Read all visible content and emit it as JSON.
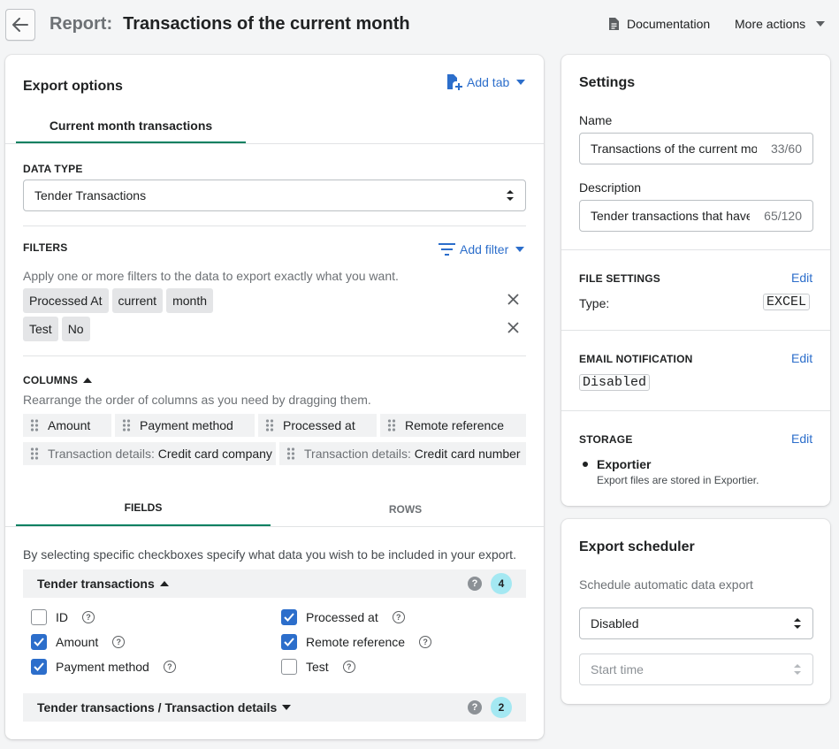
{
  "header": {
    "title_prefix": "Report:",
    "title": "Transactions of the current month",
    "documentation_label": "Documentation",
    "more_actions_label": "More actions"
  },
  "export_options": {
    "title": "Export options",
    "add_tab_label": "Add tab",
    "tabs": [
      {
        "label": "Current month transactions",
        "active": true
      }
    ],
    "data_type": {
      "heading": "DATA TYPE",
      "value": "Tender Transactions"
    },
    "filters": {
      "heading": "FILTERS",
      "add_filter_label": "Add filter",
      "description": "Apply one or more filters to the data to export exactly what you want.",
      "rows": [
        {
          "chips": [
            "Processed At",
            "current",
            "month"
          ]
        },
        {
          "chips": [
            "Test",
            "No"
          ]
        }
      ]
    },
    "columns": {
      "heading": "COLUMNS",
      "description": "Rearrange the order of columns as you need by dragging them.",
      "items": [
        {
          "prefix": "",
          "label": "Amount"
        },
        {
          "prefix": "",
          "label": "Payment method"
        },
        {
          "prefix": "",
          "label": "Processed at"
        },
        {
          "prefix": "",
          "label": "Remote reference"
        },
        {
          "prefix": "Transaction details:",
          "label": "Credit card company"
        },
        {
          "prefix": "Transaction details:",
          "label": "Credit card number"
        }
      ]
    },
    "subtabs": [
      {
        "label": "FIELDS",
        "active": true
      },
      {
        "label": "ROWS",
        "active": false
      }
    ],
    "fields_description": "By selecting specific checkboxes specify what data you wish to be included in your export.",
    "groups": [
      {
        "title": "Tender transactions",
        "count": "4",
        "expanded": true,
        "fields": [
          {
            "label": "ID",
            "checked": false
          },
          {
            "label": "Processed at",
            "checked": true
          },
          {
            "label": "Amount",
            "checked": true
          },
          {
            "label": "Remote reference",
            "checked": true
          },
          {
            "label": "Payment method",
            "checked": true
          },
          {
            "label": "Test",
            "checked": false
          }
        ]
      },
      {
        "title": "Tender transactions / Transaction details",
        "count": "2",
        "expanded": false
      }
    ]
  },
  "settings": {
    "title": "Settings",
    "name_label": "Name",
    "name_value": "Transactions of the current month",
    "name_count": "33/60",
    "description_label": "Description",
    "description_value": "Tender transactions that have been processed this month",
    "description_count": "65/120",
    "file_settings": {
      "heading": "FILE SETTINGS",
      "edit_label": "Edit",
      "type_label": "Type:",
      "type_value": "EXCEL"
    },
    "email_notification": {
      "heading": "EMAIL NOTIFICATION",
      "edit_label": "Edit",
      "value": "Disabled"
    },
    "storage": {
      "heading": "STORAGE",
      "edit_label": "Edit",
      "item_title": "Exportier",
      "item_desc": "Export files are stored in Exportier."
    }
  },
  "scheduler": {
    "title": "Export scheduler",
    "description": "Schedule automatic data export",
    "select_value": "Disabled",
    "start_time_placeholder": "Start time"
  },
  "colors": {
    "accent": "#2c6ecb",
    "tab_underline": "#008060",
    "badge": "#a4e8f2"
  }
}
